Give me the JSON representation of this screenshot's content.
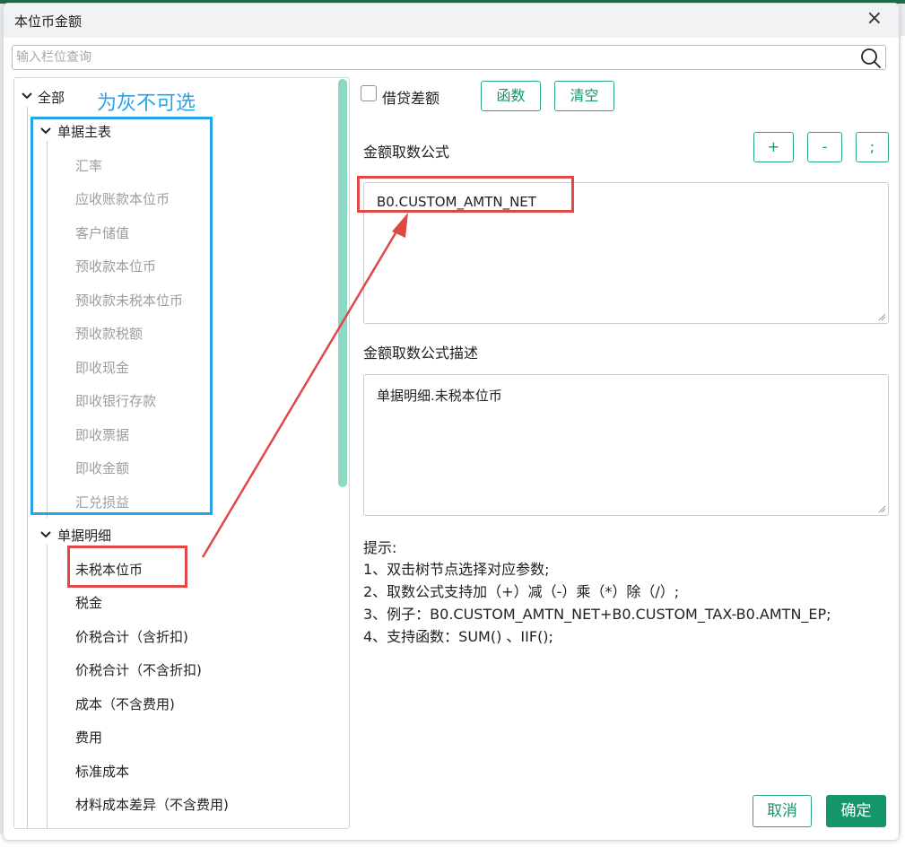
{
  "dialog": {
    "title": "本位币金额",
    "close_label": "×"
  },
  "search": {
    "placeholder": "输入栏位查询",
    "value": ""
  },
  "tree": {
    "root_label": "全部",
    "groups": [
      {
        "label": "单据主表",
        "disabled": true,
        "items": [
          "汇率",
          "应收账款本位币",
          "客户储值",
          "预收款本位币",
          "预收款未税本位币",
          "预收款税额",
          "即收现金",
          "即收银行存款",
          "即收票据",
          "即收金额",
          "汇兑损益"
        ]
      },
      {
        "label": "单据明细",
        "disabled": false,
        "items": [
          "未税本位币",
          "税金",
          "价税合计（含折扣)",
          "价税合计（不含折扣)",
          "成本（不含费用)",
          "费用",
          "标准成本",
          "材料成本差异（不含费用)"
        ]
      }
    ]
  },
  "annotations": {
    "blue_note": "为灰不可选",
    "blue_color": "#29a3e8",
    "red_color": "#e04848"
  },
  "toolbar": {
    "debit_credit_label": "借贷差额",
    "debit_credit_checked": false,
    "function_label": "函数",
    "clear_label": "清空",
    "plus_label": "+",
    "minus_label": "-",
    "semicolon_label": ";"
  },
  "formula": {
    "label": "金额取数公式",
    "value": "B0.CUSTOM_AMTN_NET"
  },
  "description": {
    "label": "金额取数公式描述",
    "value": "单据明细.未税本位币"
  },
  "hints": {
    "title": "提示:",
    "lines": [
      "1、双击树节点选择对应参数;",
      "2、取数公式支持加（+）减（-）乘（*）除（/）;",
      "3、例子：B0.CUSTOM_AMTN_NET+B0.CUSTOM_TAX-B0.AMTN_EP;",
      "4、支持函数：SUM() 、IIF();"
    ]
  },
  "footer": {
    "cancel_label": "取消",
    "ok_label": "确定"
  },
  "colors": {
    "accent": "#14956a",
    "scrollbar": "#8dd8c4",
    "disabled_text": "#9a9da0"
  }
}
